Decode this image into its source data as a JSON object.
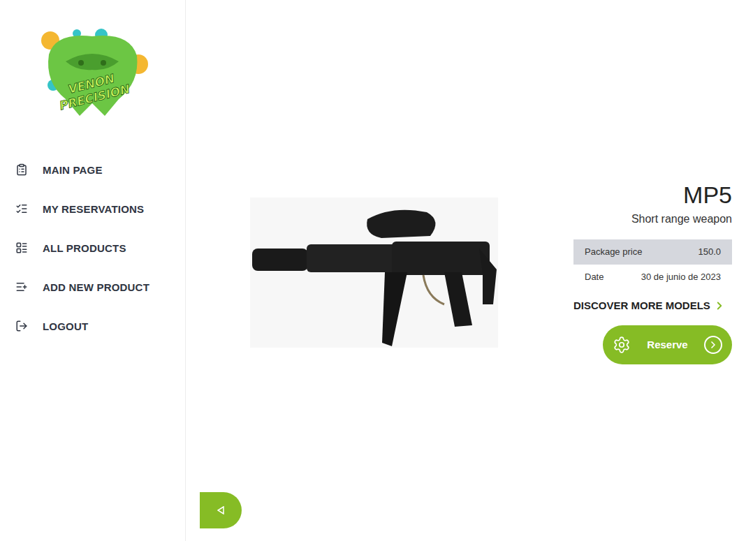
{
  "logo": {
    "lines": [
      "VENON",
      "PRECISION"
    ]
  },
  "sidebar": {
    "items": [
      {
        "label": "MAIN PAGE"
      },
      {
        "label": "MY RESERVATIONS"
      },
      {
        "label": "ALL PRODUCTS"
      },
      {
        "label": "ADD NEW PRODUCT"
      },
      {
        "label": "LOGOUT"
      }
    ]
  },
  "product": {
    "name": "MP5",
    "subtitle": "Short range weapon",
    "details": [
      {
        "label": "Package price",
        "value": "150.0",
        "highlighted": true
      },
      {
        "label": "Date",
        "value": "30 de junio de 2023",
        "highlighted": false
      }
    ]
  },
  "discover_link": "DISCOVER MORE MODELS",
  "reserve_button": "Reserve"
}
